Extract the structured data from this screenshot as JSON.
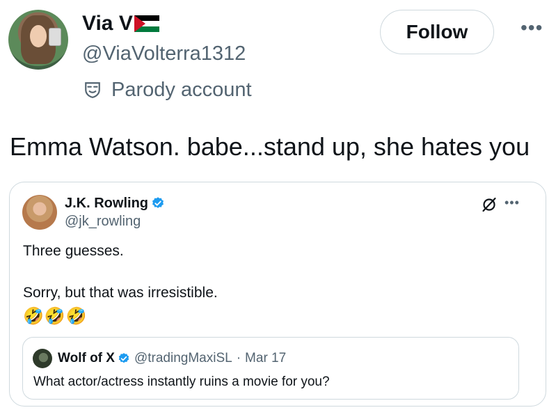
{
  "author": {
    "name": "Via V",
    "handle": "@ViaVolterra1312",
    "label": "Parody account"
  },
  "header": {
    "follow_label": "Follow",
    "more_label": "•••"
  },
  "tweet": {
    "text": "Emma Watson. babe...stand up, she hates you"
  },
  "quote": {
    "name": "J.K. Rowling",
    "handle": "@jk_rowling",
    "more_label": "•••",
    "line1": "Three guesses.",
    "line2": "Sorry, but that was irresistible.",
    "emoji": "🤣🤣🤣",
    "inner": {
      "name": "Wolf of X",
      "handle": "@tradingMaxiSL",
      "separator": "·",
      "date": "Mar 17",
      "text": "What actor/actress instantly ruins a movie for you?"
    }
  },
  "colors": {
    "text": "#0f1419",
    "secondary": "#536471",
    "border": "#cfd9de",
    "verified": "#1d9bf0"
  }
}
